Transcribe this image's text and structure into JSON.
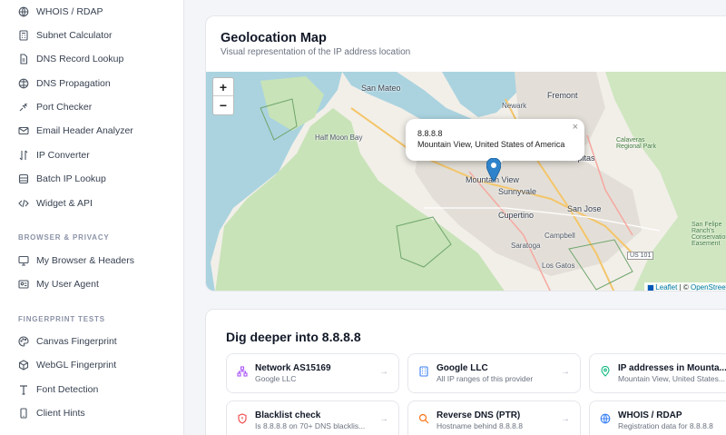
{
  "sidebar": {
    "items_top": [
      {
        "label": "WHOIS / RDAP",
        "icon": "globe-icon"
      },
      {
        "label": "Subnet Calculator",
        "icon": "calculator-icon"
      },
      {
        "label": "DNS Record Lookup",
        "icon": "document-icon"
      },
      {
        "label": "DNS Propagation",
        "icon": "globe-grid-icon"
      },
      {
        "label": "Port Checker",
        "icon": "plug-icon"
      },
      {
        "label": "Email Header Analyzer",
        "icon": "mail-icon"
      },
      {
        "label": "IP Converter",
        "icon": "swap-icon"
      },
      {
        "label": "Batch IP Lookup",
        "icon": "layers-icon"
      },
      {
        "label": "Widget & API",
        "icon": "code-icon"
      }
    ],
    "section_browser": "BROWSER & PRIVACY",
    "items_browser": [
      {
        "label": "My Browser & Headers",
        "icon": "monitor-icon"
      },
      {
        "label": "My User Agent",
        "icon": "id-card-icon"
      }
    ],
    "section_fingerprint": "FINGERPRINT TESTS",
    "items_fingerprint": [
      {
        "label": "Canvas Fingerprint",
        "icon": "palette-icon"
      },
      {
        "label": "WebGL Fingerprint",
        "icon": "cube-icon"
      },
      {
        "label": "Font Detection",
        "icon": "font-icon"
      },
      {
        "label": "Client Hints",
        "icon": "phone-icon"
      }
    ]
  },
  "map": {
    "title": "Geolocation Map",
    "subtitle": "Visual representation of the IP address location",
    "zoom_in": "+",
    "zoom_out": "−",
    "popup": {
      "ip": "8.8.8.8",
      "location": "Mountain View, United States of America",
      "close": "×"
    },
    "attribution": {
      "leaflet": "Leaflet",
      "separator": " | © ",
      "osm": "OpenStreetMa"
    },
    "places": {
      "san_mateo": "San Mateo",
      "fremont": "Fremont",
      "newark": "Newark",
      "half_moon_bay": "Half Moon Bay",
      "milpitas": "Milpitas",
      "mountain_view": "Mountain View",
      "sunnyvale": "Sunnyvale",
      "cupertino": "Cupertino",
      "san_jose": "San Jose",
      "saratoga": "Saratoga",
      "campbell": "Campbell",
      "los_gatos": "Los Gatos",
      "us101": "US 101",
      "calaveras": "Calaveras Regional Park",
      "san_felipe": "San Felipe Ranch's Conservation Easement"
    }
  },
  "dig": {
    "title": "Dig deeper into 8.8.8.8",
    "arrow": "→",
    "tiles": [
      {
        "title": "Network AS15169",
        "subtitle": "Google LLC",
        "icon": "network-icon",
        "color": "#a855f7"
      },
      {
        "title": "Google LLC",
        "subtitle": "All IP ranges of this provider",
        "icon": "building-icon",
        "color": "#3b82f6"
      },
      {
        "title": "IP addresses in Mounta...",
        "subtitle": "Mountain View, United States...",
        "icon": "map-pin-icon",
        "color": "#10b981"
      },
      {
        "title": "Blacklist check",
        "subtitle": "Is 8.8.8.8 on 70+ DNS blacklis...",
        "icon": "shield-icon",
        "color": "#ef4444"
      },
      {
        "title": "Reverse DNS (PTR)",
        "subtitle": "Hostname behind 8.8.8.8",
        "icon": "search-icon",
        "color": "#f97316"
      },
      {
        "title": "WHOIS / RDAP",
        "subtitle": "Registration data for 8.8.8.8",
        "icon": "globe-icon",
        "color": "#3b82f6"
      }
    ]
  }
}
